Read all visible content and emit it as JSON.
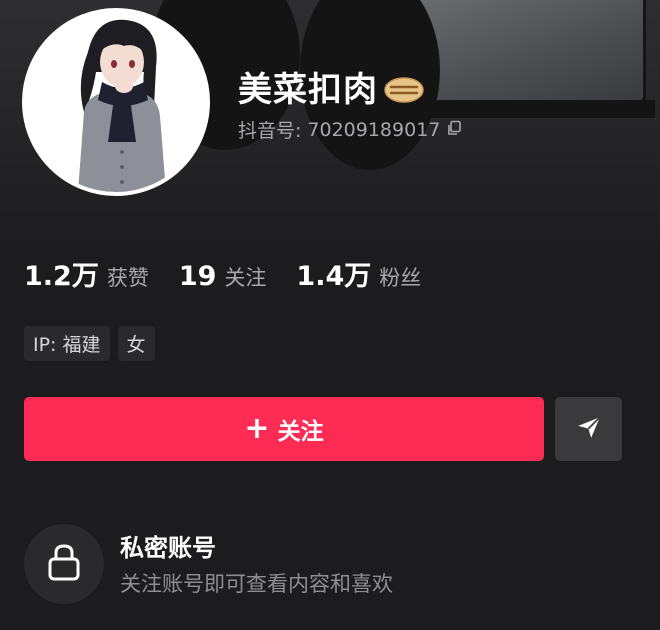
{
  "profile": {
    "username": "美菜扣肉",
    "account_id_label": "抖音号:",
    "account_id": "70209189017"
  },
  "stats": [
    {
      "value": "1.2万",
      "label": "获赞"
    },
    {
      "value": "19",
      "label": "关注"
    },
    {
      "value": "1.4万",
      "label": "粉丝"
    }
  ],
  "tags": [
    "IP: 福建",
    "女"
  ],
  "actions": {
    "follow_plus": "+",
    "follow_label": "关注"
  },
  "private": {
    "title": "私密账号",
    "description": "关注账号即可查看内容和喜欢"
  },
  "colors": {
    "accent": "#fe2c55",
    "background": "#1c1c1e",
    "secondary_text": "#a8a8ac"
  },
  "icons": {
    "badge": "burger-badge-icon",
    "copy": "copy-icon",
    "share": "send-arrow-icon",
    "lock": "lock-icon"
  }
}
